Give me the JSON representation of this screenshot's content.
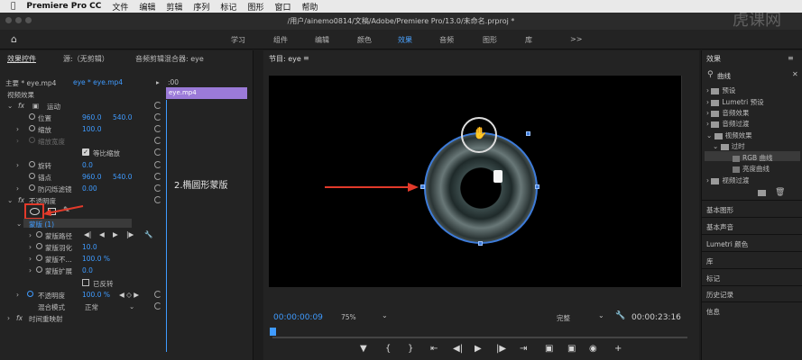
{
  "menubar": {
    "apple": "",
    "app": "Premiere Pro CC",
    "items": [
      "文件",
      "编辑",
      "剪辑",
      "序列",
      "标记",
      "图形",
      "窗口",
      "帮助"
    ]
  },
  "title": {
    "path": "/用户/ainemo0814/文稿/Adobe/Premiere Pro/13.0/未命名.prproj *"
  },
  "workspaces": {
    "items": [
      "学习",
      "组件",
      "编辑",
      "颜色",
      "效果",
      "音频",
      "图形",
      "库"
    ],
    "active": "效果",
    "more": ">>"
  },
  "effect_controls": {
    "tab": "效果控件",
    "tab_source": "源:（无剪辑）",
    "tab_mixer": "音频剪辑混合器: eye",
    "master": "主要 * eye.mp4",
    "clip": "eye * eye.mp4",
    "timecode_start": ":00",
    "clip_name": "eye.mp4",
    "section": "视频效果",
    "motion": "运动",
    "position_label": "位置",
    "position_x": "960.0",
    "position_y": "540.0",
    "scale_label": "缩放",
    "scale_value": "100.0",
    "scale_width_label": "缩放宽度",
    "uniform_scale": "等比缩放",
    "rotation_label": "旋转",
    "rotation_value": "0.0",
    "anchor_label": "锚点",
    "anchor_x": "960.0",
    "anchor_y": "540.0",
    "flicker_label": "防闪烁滤镜",
    "flicker_value": "0.00",
    "opacity_section": "不透明度",
    "mask_label": "蒙版 (1)",
    "mask_path": "蒙版路径",
    "mask_feather": "蒙版羽化",
    "mask_feather_value": "10.0",
    "mask_opacity": "蒙版不...",
    "mask_opacity_value": "100.0 %",
    "mask_expansion": "蒙版扩展",
    "mask_expansion_value": "0.0",
    "inverted": "已反转",
    "opacity_label": "不透明度",
    "opacity_value": "100.0 %",
    "blend_label": "混合模式",
    "blend_value": "正常",
    "time_remap": "时间重映射",
    "annotation": "2.椭圆形蒙版"
  },
  "program": {
    "title": "节目: eye",
    "timecode": "00:00:00:09",
    "zoom": "75%",
    "quality": "完整",
    "duration": "00:00:23:16"
  },
  "effects_panel": {
    "title": "效果",
    "search": "曲线",
    "tree": [
      {
        "label": "预设",
        "level": 0
      },
      {
        "label": "Lumetri 预设",
        "level": 0
      },
      {
        "label": "音频效果",
        "level": 0
      },
      {
        "label": "音频过渡",
        "level": 0
      },
      {
        "label": "视频效果",
        "level": 0
      },
      {
        "label": "过时",
        "level": 1
      },
      {
        "label": "RGB 曲线",
        "level": 2
      },
      {
        "label": "亮度曲线",
        "level": 2
      },
      {
        "label": "视频过渡",
        "level": 0
      }
    ],
    "sections": [
      "基本图形",
      "基本声音",
      "Lumetri 颜色",
      "库",
      "标记",
      "历史记录",
      "信息"
    ]
  },
  "watermark": "虎课网"
}
